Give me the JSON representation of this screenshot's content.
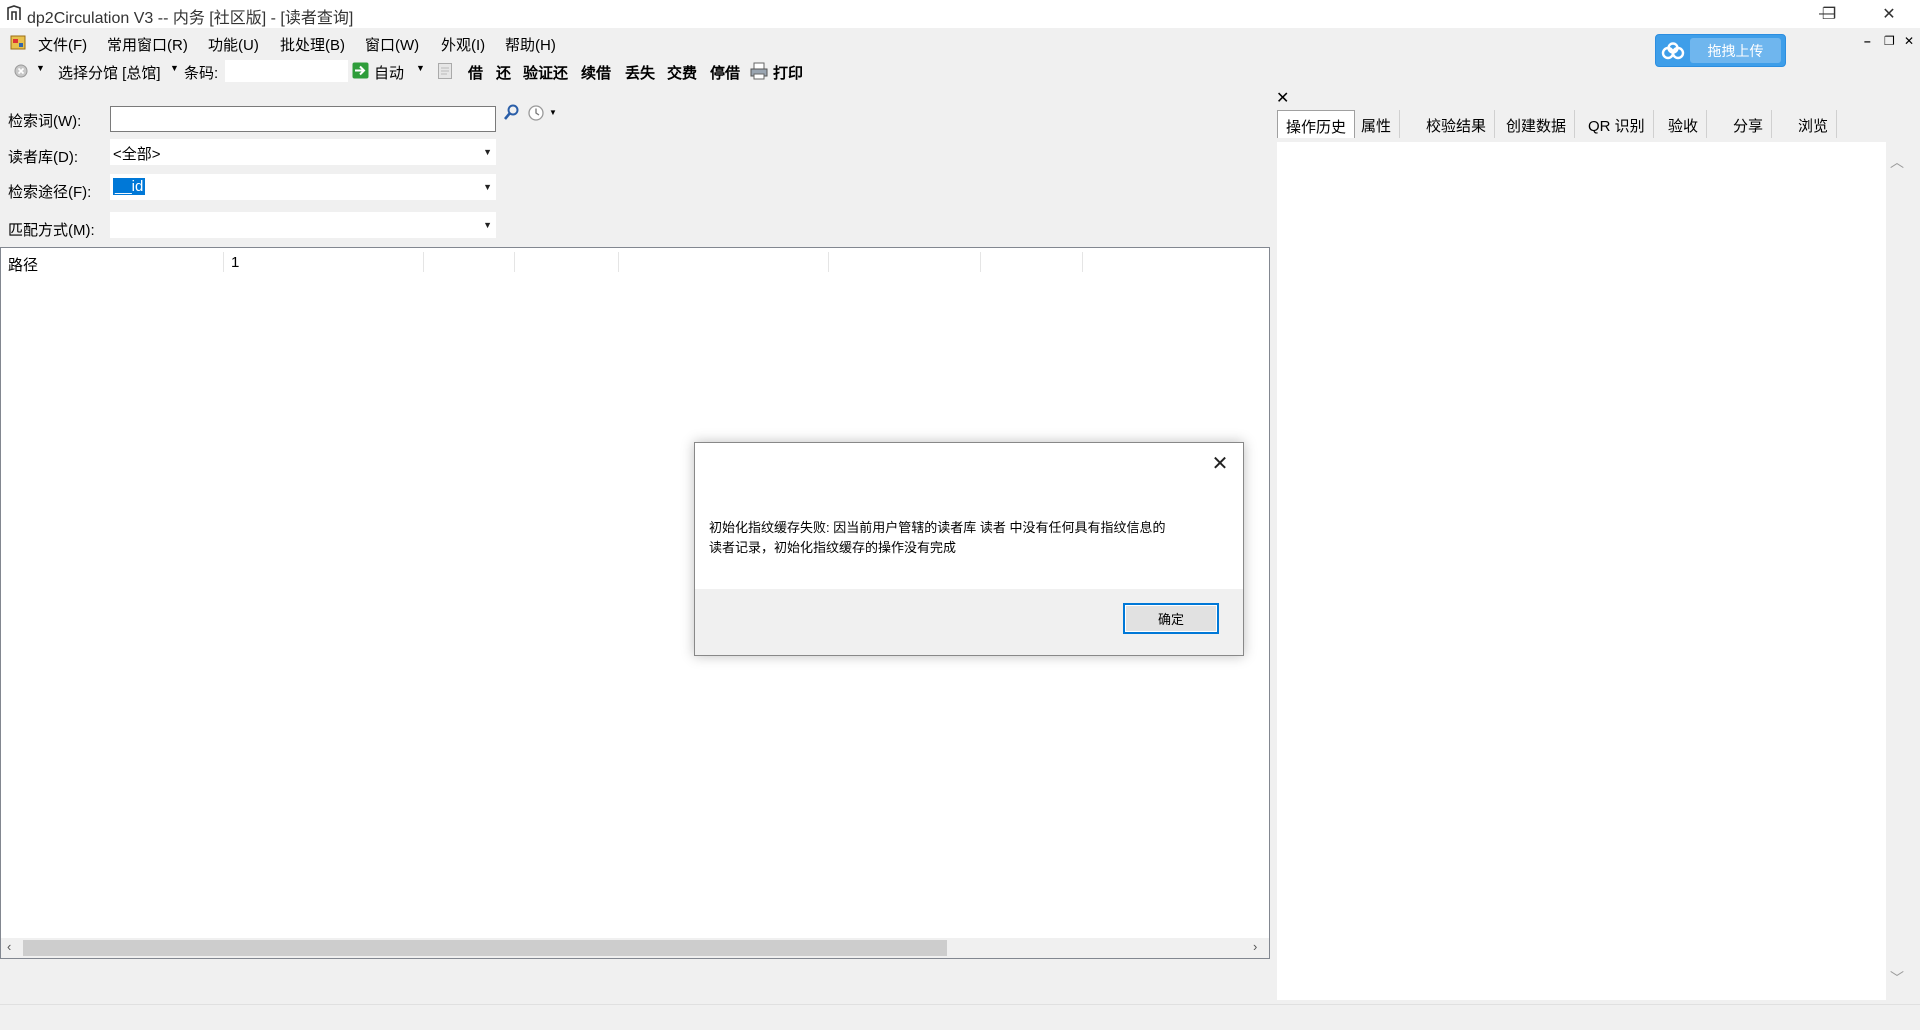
{
  "window": {
    "title": "dp2Circulation V3 -- 内务 [社区版] - [读者查询]",
    "minimize": "—",
    "restore": "❐",
    "close": "✕"
  },
  "menubar": {
    "items": [
      "文件(F)",
      "常用窗口(R)",
      "功能(U)",
      "批处理(B)",
      "窗口(W)",
      "外观(I)",
      "帮助(H)"
    ],
    "mdi_minimize": "–",
    "mdi_restore": "❐",
    "mdi_close": "✕"
  },
  "upload": {
    "label": "拖拽上传"
  },
  "toolbar": {
    "branch_label": "选择分馆 [总馆]",
    "barcode_label": "条码:",
    "barcode_value": "",
    "auto_label": "自动",
    "borrow": "借",
    "return": "还",
    "verify_return": "验证还",
    "renew": "续借",
    "lost": "丢失",
    "pay": "交费",
    "suspend": "停借",
    "print": "打印"
  },
  "form": {
    "search_label": "检索词(W):",
    "search_value": "",
    "db_label": "读者库(D):",
    "db_value": "<全部>",
    "path_label": "检索途径(F):",
    "path_value": "__id",
    "match_label": "匹配方式(M):",
    "match_value": ""
  },
  "results": {
    "columns": [
      "路径",
      "1",
      "",
      "",
      "",
      "",
      "",
      ""
    ],
    "rows": []
  },
  "right_panel": {
    "tabs": [
      "操作历史",
      "属性",
      "校验结果",
      "创建数据",
      "QR 识别",
      "验收",
      "分享",
      "浏览"
    ],
    "active_tab": "操作历史"
  },
  "dialog": {
    "message_line1": "初始化指纹缓存失败: 因当前用户管辖的读者库 读者 中没有任何具有指纹信息的",
    "message_line2": "读者记录，初始化指纹缓存的操作没有完成",
    "ok_label": "确定",
    "accent": "#0078d7"
  },
  "colors": {
    "upload_accent": "#3e9ee9",
    "selection": "#0078d7"
  }
}
